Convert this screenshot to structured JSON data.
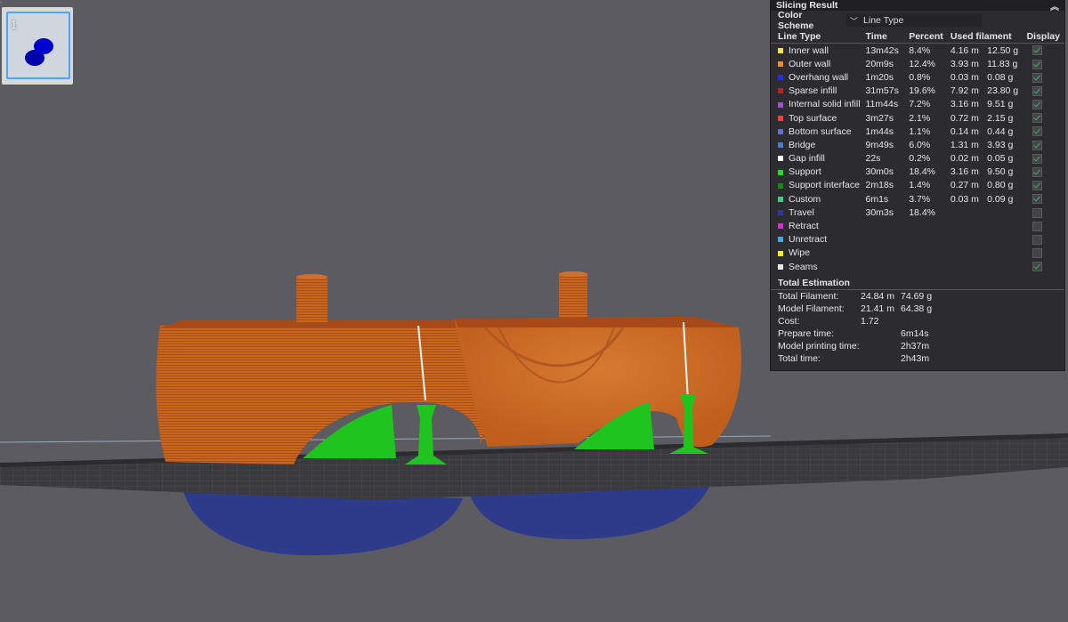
{
  "panel": {
    "title": "Slicing Result",
    "color_scheme_label": "Color Scheme",
    "color_scheme_value": "Line Type",
    "columns": [
      "Line Type",
      "Time",
      "Percent",
      "Used filament",
      "Display"
    ],
    "rows": [
      {
        "name": "Inner wall",
        "color": "#f4e34a",
        "time": "13m42s",
        "percent": "8.4%",
        "length": "4.16 m",
        "weight": "12.50 g",
        "display": true
      },
      {
        "name": "Outer wall",
        "color": "#f08a2e",
        "time": "20m9s",
        "percent": "12.4%",
        "length": "3.93 m",
        "weight": "11.83 g",
        "display": true
      },
      {
        "name": "Overhang wall",
        "color": "#2a2ae0",
        "time": "1m20s",
        "percent": "0.8%",
        "length": "0.03 m",
        "weight": "0.08 g",
        "display": true
      },
      {
        "name": "Sparse infill",
        "color": "#b02424",
        "time": "31m57s",
        "percent": "19.6%",
        "length": "7.92 m",
        "weight": "23.80 g",
        "display": true
      },
      {
        "name": "Internal solid infill",
        "color": "#a050d0",
        "time": "11m44s",
        "percent": "7.2%",
        "length": "3.16 m",
        "weight": "9.51 g",
        "display": true
      },
      {
        "name": "Top surface",
        "color": "#f04040",
        "time": "3m27s",
        "percent": "2.1%",
        "length": "0.72 m",
        "weight": "2.15 g",
        "display": true
      },
      {
        "name": "Bottom surface",
        "color": "#6a6ad0",
        "time": "1m44s",
        "percent": "1.1%",
        "length": "0.14 m",
        "weight": "0.44 g",
        "display": true
      },
      {
        "name": "Bridge",
        "color": "#4a7ac8",
        "time": "9m49s",
        "percent": "6.0%",
        "length": "1.31 m",
        "weight": "3.93 g",
        "display": true
      },
      {
        "name": "Gap infill",
        "color": "#ffffff",
        "time": "22s",
        "percent": "0.2%",
        "length": "0.02 m",
        "weight": "0.05 g",
        "display": true
      },
      {
        "name": "Support",
        "color": "#22dd22",
        "time": "30m0s",
        "percent": "18.4%",
        "length": "3.16 m",
        "weight": "9.50 g",
        "display": true
      },
      {
        "name": "Support interface",
        "color": "#118a11",
        "time": "2m18s",
        "percent": "1.4%",
        "length": "0.27 m",
        "weight": "0.80 g",
        "display": true
      },
      {
        "name": "Custom",
        "color": "#44cc88",
        "time": "6m1s",
        "percent": "3.7%",
        "length": "0.03 m",
        "weight": "0.09 g",
        "display": true
      },
      {
        "name": "Travel",
        "color": "#2a3a9a",
        "time": "30m3s",
        "percent": "18.4%",
        "length": "",
        "weight": "",
        "display": false
      },
      {
        "name": "Retract",
        "color": "#d030d0",
        "time": "",
        "percent": "",
        "length": "",
        "weight": "",
        "display": false
      },
      {
        "name": "Unretract",
        "color": "#40a8e0",
        "time": "",
        "percent": "",
        "length": "",
        "weight": "",
        "display": false
      },
      {
        "name": "Wipe",
        "color": "#f4f020",
        "time": "",
        "percent": "",
        "length": "",
        "weight": "",
        "display": false
      },
      {
        "name": "Seams",
        "color": "#e8e8e8",
        "time": "",
        "percent": "",
        "length": "",
        "weight": "",
        "display": true
      }
    ],
    "estimation_title": "Total Estimation",
    "estimation": [
      {
        "label": "Total Filament:",
        "v1": "24.84 m",
        "v2": "74.69 g"
      },
      {
        "label": "Model Filament:",
        "v1": "21.41 m",
        "v2": "64.38 g"
      },
      {
        "label": "Cost:",
        "v1": "1.72",
        "v2": ""
      },
      {
        "label": "Prepare time:",
        "v1": "",
        "v2": "6m14s"
      },
      {
        "label": "Model printing time:",
        "v1": "",
        "v2": "2h37m"
      },
      {
        "label": "Total time:",
        "v1": "",
        "v2": "2h43m"
      }
    ]
  },
  "thumbnail": {
    "number": "1"
  },
  "colors": {
    "background": "#5b5b61",
    "model": "#c9651e",
    "support": "#1fc41f",
    "travel": "#2e3a8a",
    "accent": "#4da3ff"
  }
}
